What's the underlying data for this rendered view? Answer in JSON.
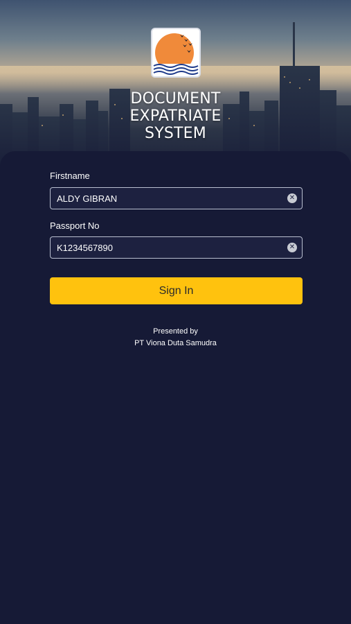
{
  "header": {
    "title_line1": "DOCUMENT",
    "title_line2": "EXPATRIATE",
    "title_line3": "SYSTEM",
    "logo_icon": "sun-birds-waves-logo-icon"
  },
  "form": {
    "firstname": {
      "label": "Firstname",
      "value": "ALDY GIBRAN"
    },
    "passport": {
      "label": "Passport No",
      "value": "K1234567890"
    },
    "clear_icon": "clear-circle-icon",
    "signin_label": "Sign In"
  },
  "footer": {
    "presented_by": "Presented by",
    "company": "PT Viona Duta Samudra"
  },
  "colors": {
    "background": "#161a36",
    "button": "#ffc20e",
    "logo_sun": "#f08a3a",
    "logo_waves": "#1e3a8a"
  }
}
